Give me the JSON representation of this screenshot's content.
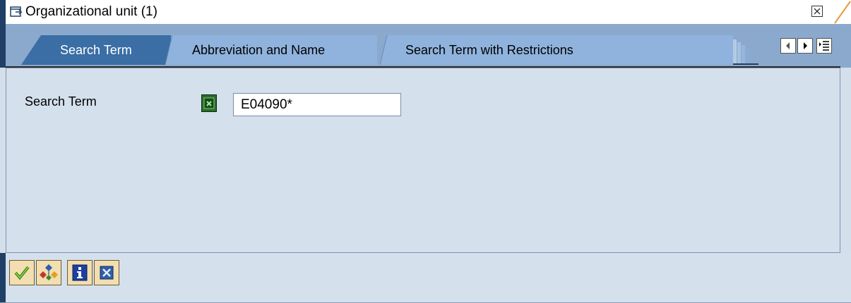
{
  "window": {
    "title": "Organizational unit (1)",
    "icons": {
      "title": "window-pointer-icon",
      "close": "close-x-icon"
    }
  },
  "tabs": [
    {
      "label": "Search Term",
      "active": true
    },
    {
      "label": "Abbreviation and Name",
      "active": false
    },
    {
      "label": "Search Term with Restrictions",
      "active": false
    }
  ],
  "tab_nav": {
    "icons": [
      "scroll-left-icon",
      "scroll-right-icon",
      "tab-list-icon"
    ]
  },
  "form": {
    "search_term_label": "Search Term",
    "search_term_value": "E04090*",
    "match_button_icon": "selection-options-icon"
  },
  "footer_buttons": [
    {
      "icon": "checkmark-icon",
      "action": "continue"
    },
    {
      "icon": "hierarchy-icon",
      "action": "structure search"
    },
    {
      "icon": "info-icon",
      "action": "information"
    },
    {
      "icon": "cancel-icon",
      "action": "cancel"
    }
  ],
  "colors": {
    "tab_active": "#3a6ea5",
    "tab_inactive": "#8fb3dd",
    "panel": "#d5e0ed",
    "frame_dark": "#1f3f66",
    "footer_button": "#f2deb0"
  }
}
